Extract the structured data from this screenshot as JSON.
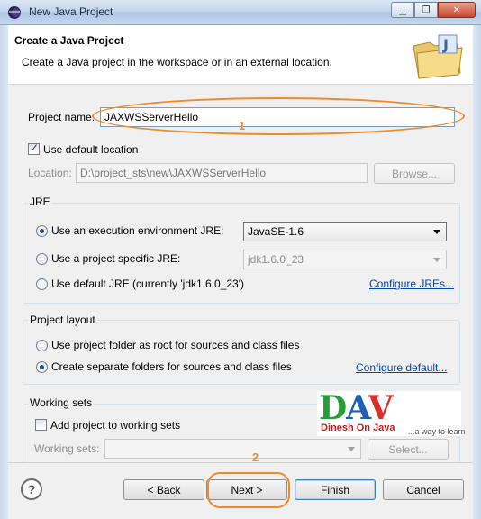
{
  "window": {
    "title": "New Java Project",
    "min": "▁",
    "max": "❐",
    "close": "✕"
  },
  "header": {
    "title": "Create a Java Project",
    "description": "Create a Java project in the workspace or in an external location."
  },
  "project": {
    "name_label": "Project name:",
    "name_value": "JAXWSServerHello"
  },
  "location": {
    "use_default_label": "Use default location",
    "use_default_checked": true,
    "location_label": "Location:",
    "location_value": "D:\\project_sts\\new\\JAXWSServerHello",
    "browse_label": "Browse..."
  },
  "jre": {
    "group_title": "JRE",
    "option_env": "Use an execution environment JRE:",
    "option_env_value": "JavaSE-1.6",
    "option_specific": "Use a project specific JRE:",
    "option_specific_value": "jdk1.6.0_23",
    "option_default": "Use default JRE (currently 'jdk1.6.0_23')",
    "configure_link": "Configure JREs..."
  },
  "layout": {
    "group_title": "Project layout",
    "option_root": "Use project folder as root for sources and class files",
    "option_separate": "Create separate folders for sources and class files",
    "configure_link": "Configure default..."
  },
  "working_sets": {
    "group_title": "Working sets",
    "add_label": "Add project to working sets",
    "sets_label": "Working sets:",
    "select_label": "Select..."
  },
  "logo": {
    "letters": "DAV",
    "subtitle": "Dinesh On Java",
    "tagline": "...a way to learn"
  },
  "annotations": {
    "one": "1",
    "two": "2"
  },
  "footer": {
    "help": "?",
    "back": "< Back",
    "next": "Next >",
    "finish": "Finish",
    "cancel": "Cancel"
  },
  "colors": {
    "annotation": "#ef8a2a",
    "link": "#0645ad",
    "title_bar": "#bfd3ea"
  }
}
